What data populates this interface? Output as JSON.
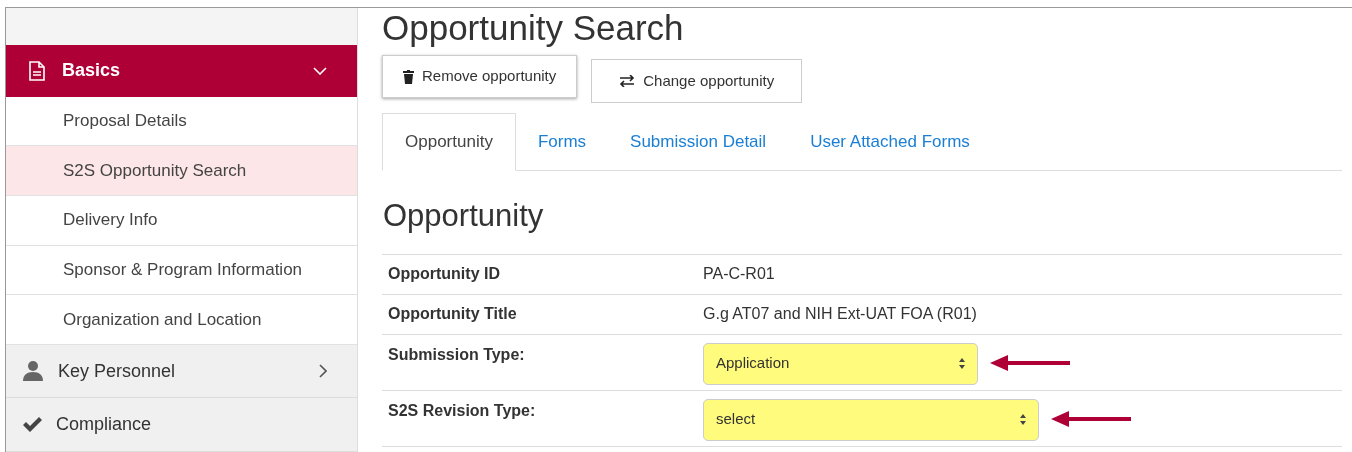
{
  "sidebar": {
    "sections": [
      {
        "label": "Basics",
        "expanded": true,
        "items": [
          {
            "label": "Proposal Details",
            "selected": false
          },
          {
            "label": "S2S Opportunity Search",
            "selected": true
          },
          {
            "label": "Delivery Info",
            "selected": false
          },
          {
            "label": "Sponsor & Program Information",
            "selected": false
          },
          {
            "label": "Organization and Location",
            "selected": false
          }
        ]
      },
      {
        "label": "Key Personnel",
        "expanded": false
      },
      {
        "label": "Compliance"
      }
    ]
  },
  "page_title": "Opportunity Search",
  "buttons": [
    {
      "label": "Remove opportunity"
    },
    {
      "label": "Change opportunity"
    }
  ],
  "tabs": [
    {
      "label": "Opportunity",
      "selected": true
    },
    {
      "label": "Forms",
      "selected": false
    },
    {
      "label": "Submission Detail",
      "selected": false
    },
    {
      "label": "User Attached Forms",
      "selected": false
    }
  ],
  "section_title": "Opportunity",
  "fields": [
    {
      "kind": "text",
      "label": "Opportunity ID",
      "value": "PA-C-R01"
    },
    {
      "kind": "text",
      "label": "Opportunity Title",
      "value": "G.g AT07 and NIH Ext-UAT FOA (R01)"
    },
    {
      "kind": "select",
      "label": "Submission Type:",
      "value": "Application",
      "highlighted": true
    },
    {
      "kind": "select",
      "label": "S2S Revision Type:",
      "value": "select",
      "highlighted": true
    }
  ]
}
